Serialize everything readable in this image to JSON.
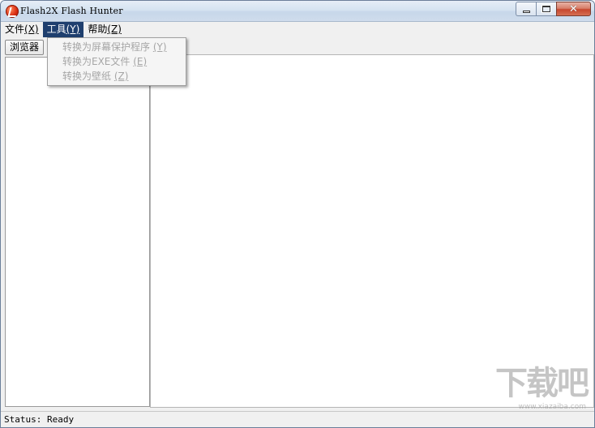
{
  "window": {
    "title": "Flash2X Flash Hunter"
  },
  "menubar": {
    "items": [
      {
        "label": "文件",
        "accel": "(X)"
      },
      {
        "label": "工具",
        "accel": "(Y)"
      },
      {
        "label": "帮助",
        "accel": "(Z)"
      }
    ]
  },
  "tools_menu": {
    "items": [
      {
        "label": "转换为屏幕保护程序",
        "accel": "(Y)"
      },
      {
        "label": "转换为EXE文件",
        "accel": "(E)"
      },
      {
        "label": "转换为壁纸",
        "accel": "(Z)"
      }
    ]
  },
  "toolbar": {
    "browser_tab_label": "浏览器"
  },
  "statusbar": {
    "text": "Status: Ready"
  },
  "watermark": {
    "main": "下载吧",
    "sub": "www.xiazaiba.com"
  },
  "colors": {
    "menu_highlight": "#1f3f6e",
    "disabled_text": "#a6a6a6",
    "close_button": "#c7472e"
  },
  "icons": {
    "app": "flash-app-icon",
    "minimize": "minimize-icon",
    "maximize": "maximize-icon",
    "close": "close-icon"
  }
}
